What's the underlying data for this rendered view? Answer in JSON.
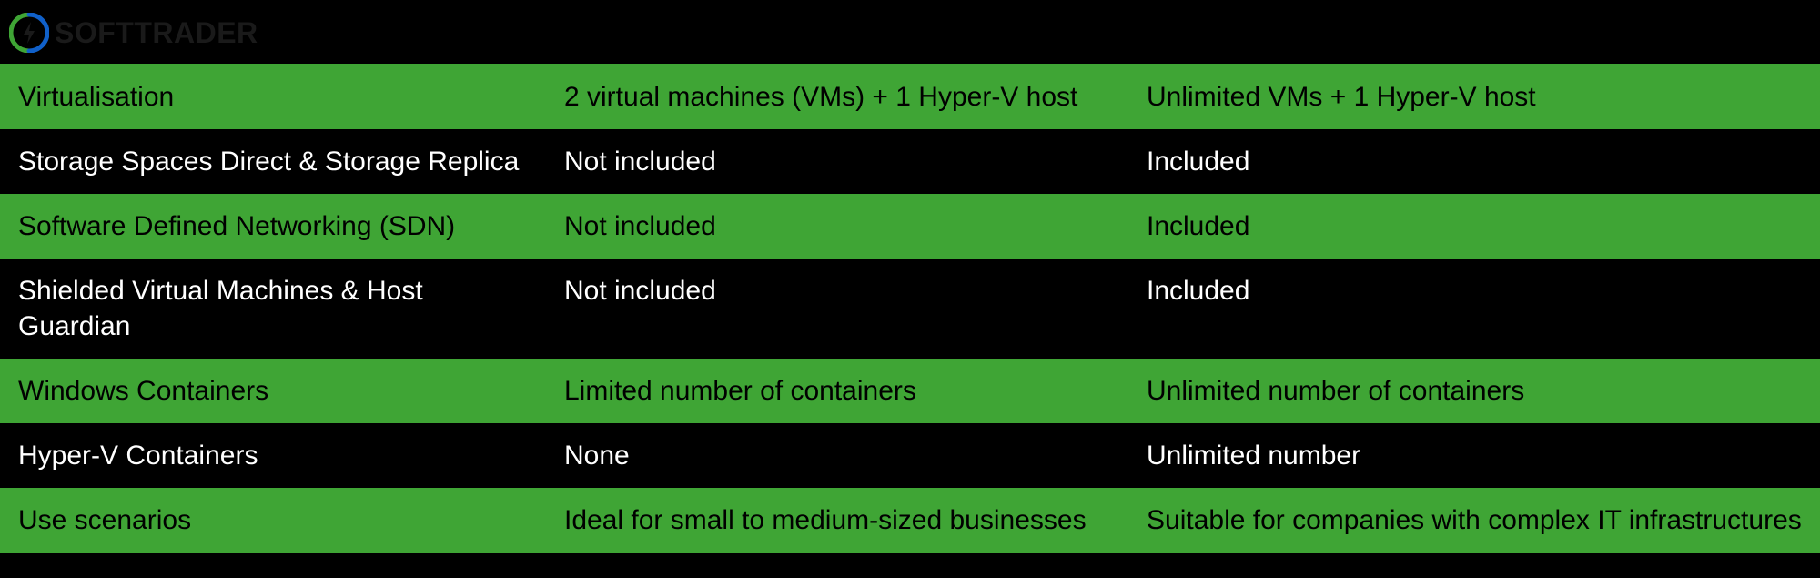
{
  "logo": {
    "text": "SOFTTRADER"
  },
  "table": {
    "rows": [
      {
        "type": "green",
        "feature": "Virtualisation",
        "standard": "2 virtual machines (VMs) + 1 Hyper-V host",
        "datacentre": "Unlimited VMs + 1 Hyper-V host"
      },
      {
        "type": "black",
        "feature": "Storage Spaces Direct & Storage Replica",
        "standard": "Not included",
        "datacentre": "Included"
      },
      {
        "type": "green",
        "feature": "Software Defined Networking (SDN)",
        "standard": "Not included",
        "datacentre": "Included"
      },
      {
        "type": "black",
        "feature": "Shielded Virtual Machines & Host Guardian",
        "standard": "Not included",
        "datacentre": "Included"
      },
      {
        "type": "green",
        "feature": "Windows Containers",
        "standard": "Limited number of containers",
        "datacentre": "Unlimited number of containers"
      },
      {
        "type": "black",
        "feature": "Hyper-V Containers",
        "standard": "None",
        "datacentre": "Unlimited number"
      },
      {
        "type": "green",
        "feature": "Use scenarios",
        "standard": "Ideal for small to medium-sized businesses",
        "datacentre": "Suitable for companies with complex IT infrastructures"
      }
    ]
  }
}
